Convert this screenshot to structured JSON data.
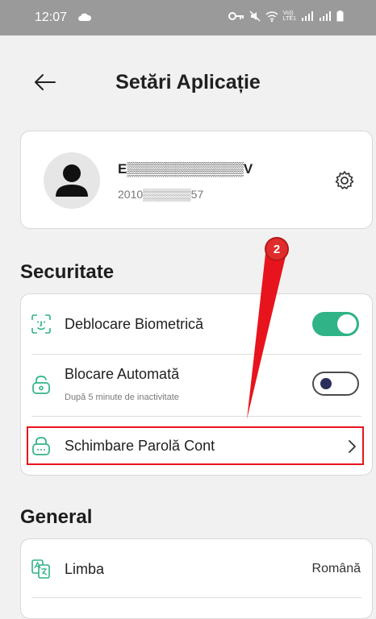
{
  "status_bar": {
    "time": "12:07",
    "lte_label": "Vo))\nLTE1"
  },
  "header": {
    "title": "Setări Aplicație"
  },
  "profile": {
    "name": "E▒▒▒▒▒▒▒▒▒▒▒▒V",
    "id": "2010▒▒▒▒▒▒57"
  },
  "sections": {
    "security_title": "Securitate",
    "general_title": "General"
  },
  "security": {
    "biometric_label": "Deblocare Biometrică",
    "biometric_enabled": true,
    "autolock_label": "Blocare Automată",
    "autolock_sub": "După 5 minute de inactivitate",
    "autolock_enabled": false,
    "change_password_label": "Schimbare Parolă Cont"
  },
  "general": {
    "language_label": "Limba",
    "language_value": "Română"
  },
  "annotation": {
    "step_number": "2",
    "color": "#e8141d"
  },
  "colors": {
    "toggle_on": "#2fb387",
    "status_bar": "#9a9a9a"
  }
}
